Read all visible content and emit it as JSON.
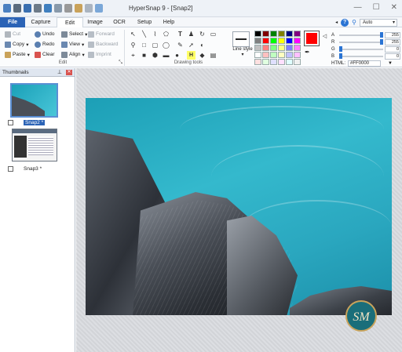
{
  "window": {
    "title": "HyperSnap 9 - [Snap2]"
  },
  "menu": {
    "items": [
      "File",
      "Capture",
      "Edit",
      "Image",
      "OCR",
      "Setup",
      "Help"
    ],
    "zoom_value": "Auto"
  },
  "ribbon": {
    "edit_group": {
      "cut": "Cut",
      "copy": "Copy",
      "paste": "Paste",
      "undo": "Undo",
      "redo": "Redo",
      "clear": "Clear",
      "select": "Select",
      "view": "View",
      "align": "Align",
      "forward": "Forward",
      "backward": "Backward",
      "imprint": "Imprint",
      "label": "Edit"
    },
    "drawing_group": {
      "label": "Drawing tools",
      "line_style": "Line style"
    },
    "color": {
      "foreground": "#ff0000",
      "argb": [
        {
          "label": "A",
          "value": "255",
          "level": 1.0
        },
        {
          "label": "R",
          "value": "255",
          "level": 1.0
        },
        {
          "label": "G",
          "value": "0",
          "level": 0.0
        },
        {
          "label": "B",
          "value": "0",
          "level": 0.0
        }
      ],
      "html_label": "HTML:",
      "html_value": "#FF0000",
      "palette": [
        "#000000",
        "#800000",
        "#008000",
        "#808000",
        "#000080",
        "#800080",
        "#808080",
        "#ff0000",
        "#00ff00",
        "#ffff00",
        "#0000ff",
        "#ff00ff",
        "#c0c0c0",
        "#ff8080",
        "#80ff80",
        "#ffff80",
        "#8080ff",
        "#ff80ff",
        "#ffffff",
        "#ffc0c0",
        "#c0ffc0",
        "#ffffc0",
        "#c0c0ff",
        "#ffc0ff",
        "#ffe0e0",
        "#e0ffe0",
        "#e0e0ff",
        "#ffe0ff",
        "#e0ffff",
        "#f0f0f0"
      ]
    }
  },
  "thumbnails": {
    "header": "Thumbnails",
    "items": [
      {
        "label": "Snap2 *",
        "selected": true
      },
      {
        "label": "Snap3 *",
        "selected": false
      }
    ]
  },
  "logo_text": "SM"
}
